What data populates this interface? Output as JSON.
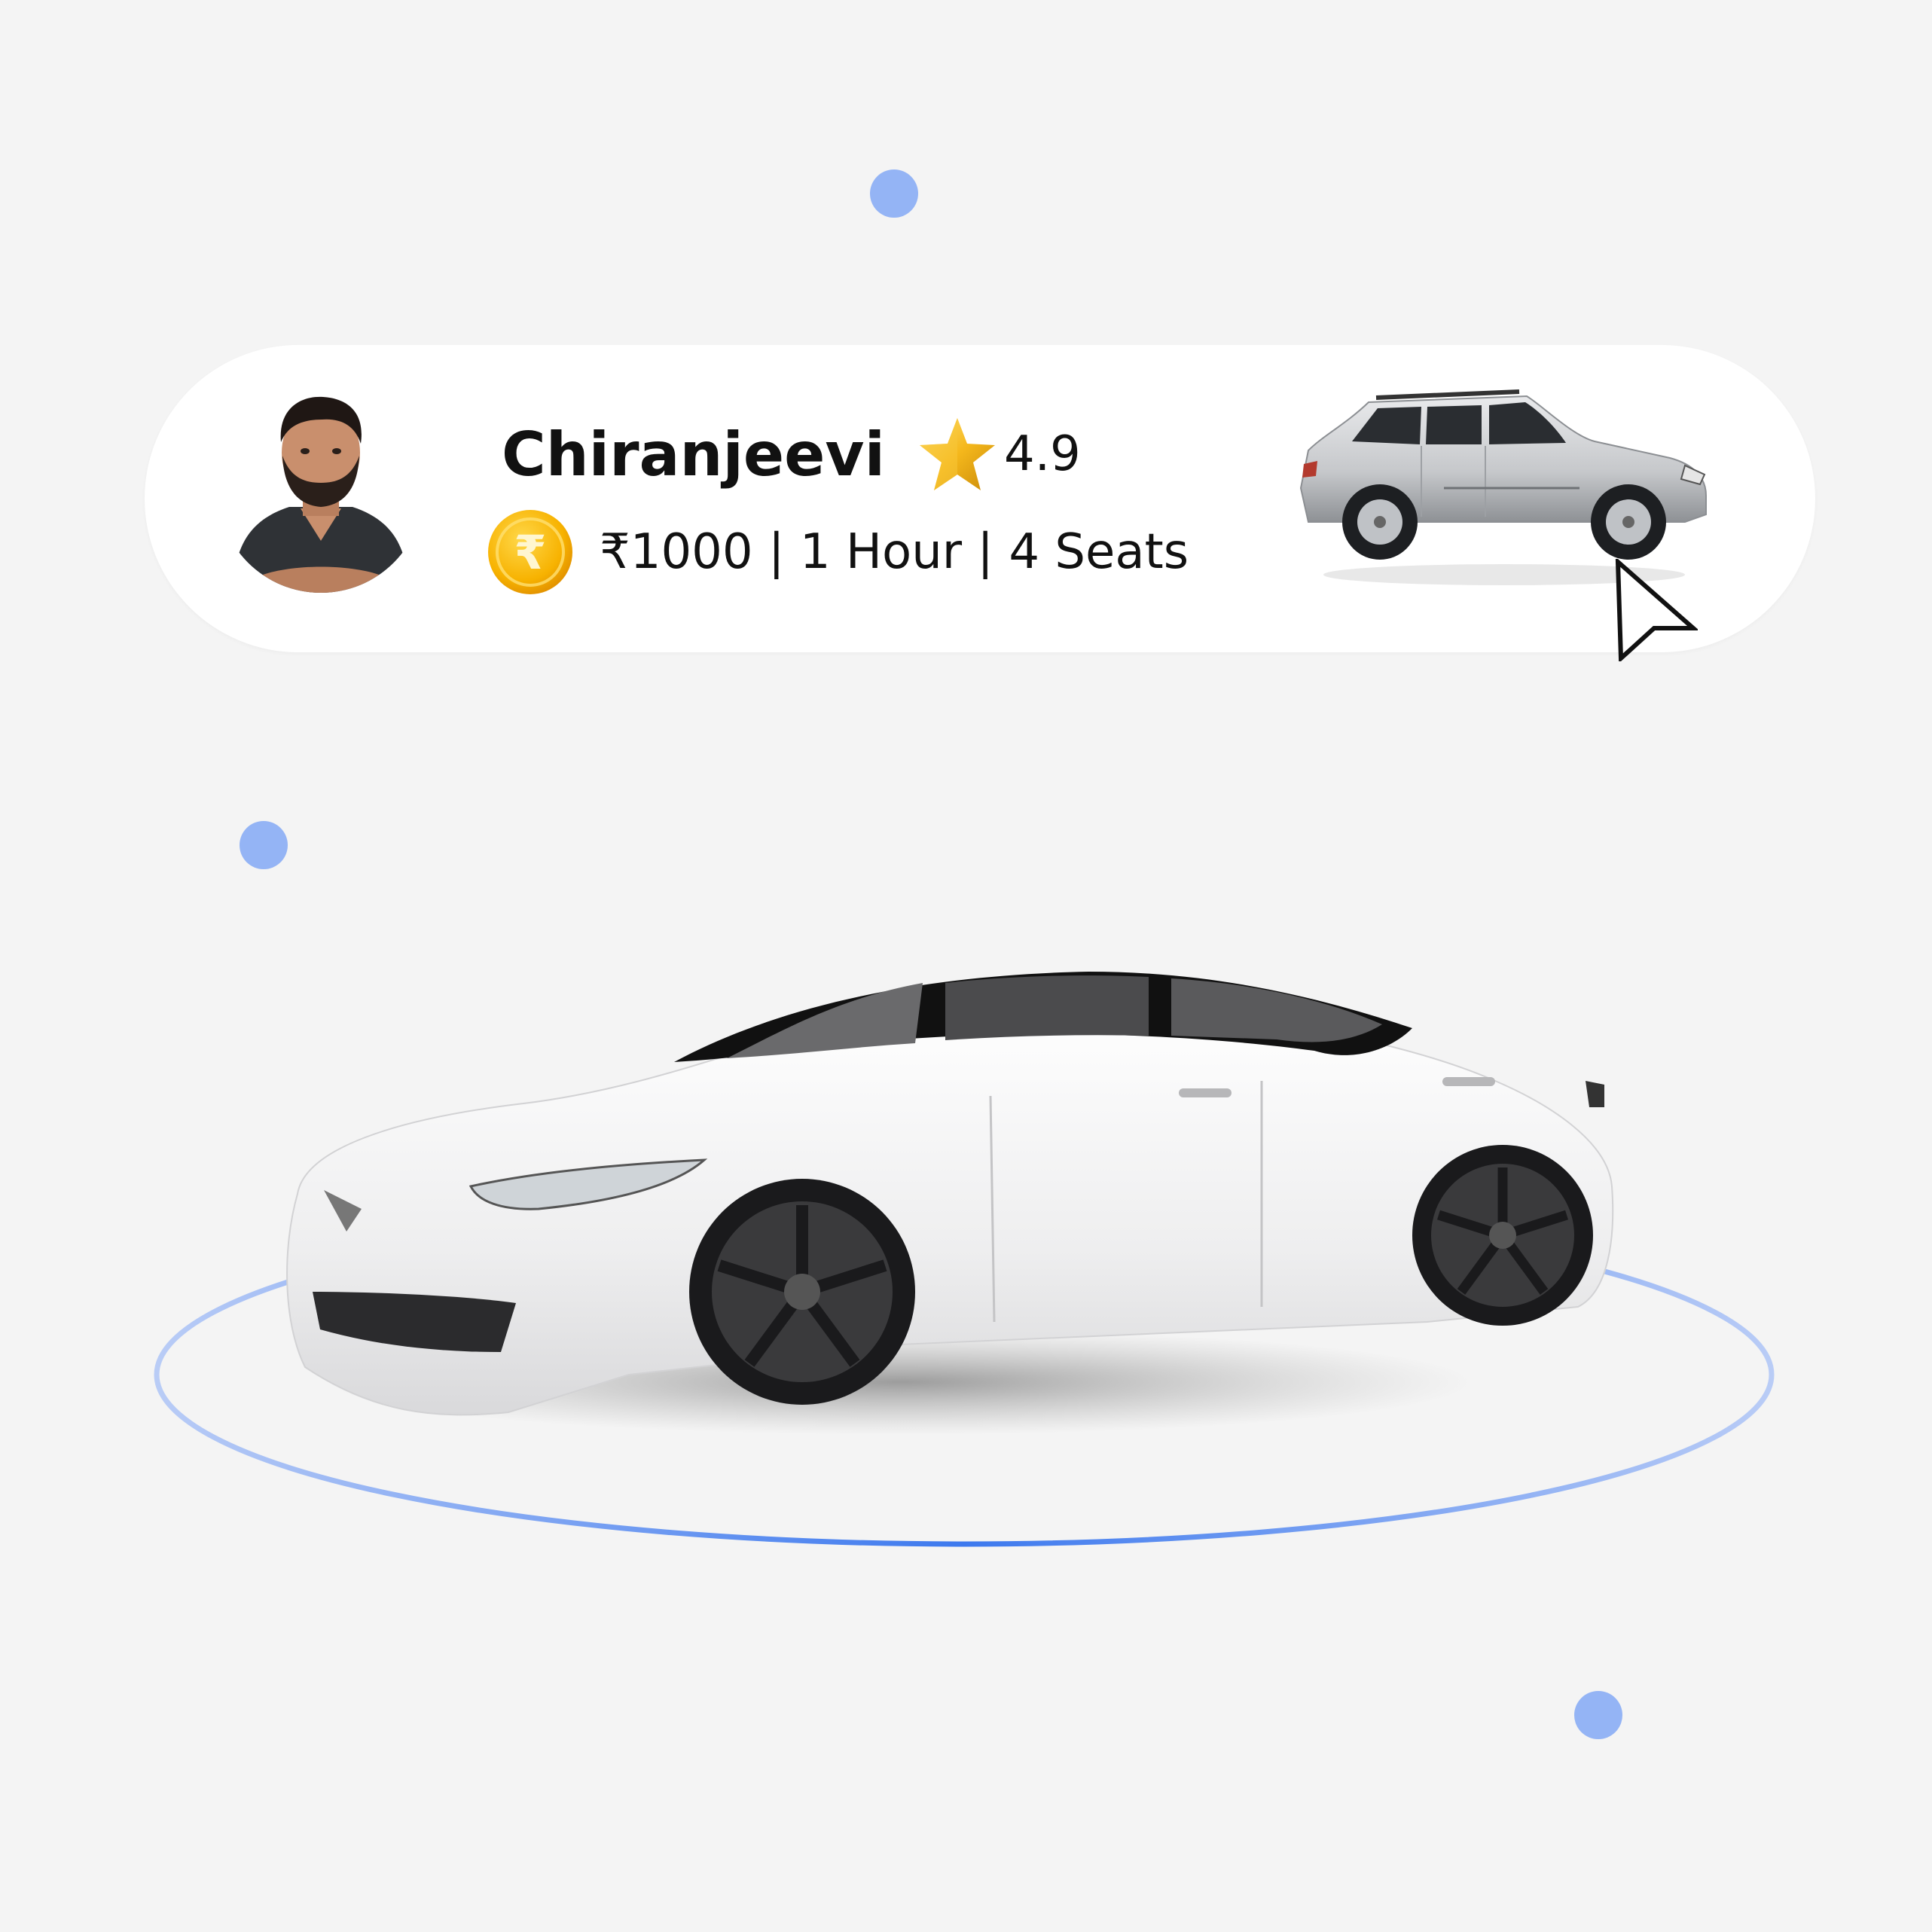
{
  "driver": {
    "name": "Chiranjeevi",
    "rating": "4.9",
    "details": "₹1000 | 1 Hour | 4 Seats"
  },
  "icons": {
    "avatar": "driver-avatar-photo",
    "rating": "star-icon",
    "price": "rupee-coin-icon",
    "vehicle": "suv-car-image",
    "pointer": "mouse-cursor-icon",
    "hero": "white-sedan-image"
  },
  "colors": {
    "background": "#f4f4f4",
    "card": "#ffffff",
    "accent_dot": "#94b4f5",
    "ring": "#3d79ee",
    "star": "#f2b816",
    "coin": "#f7b200"
  }
}
